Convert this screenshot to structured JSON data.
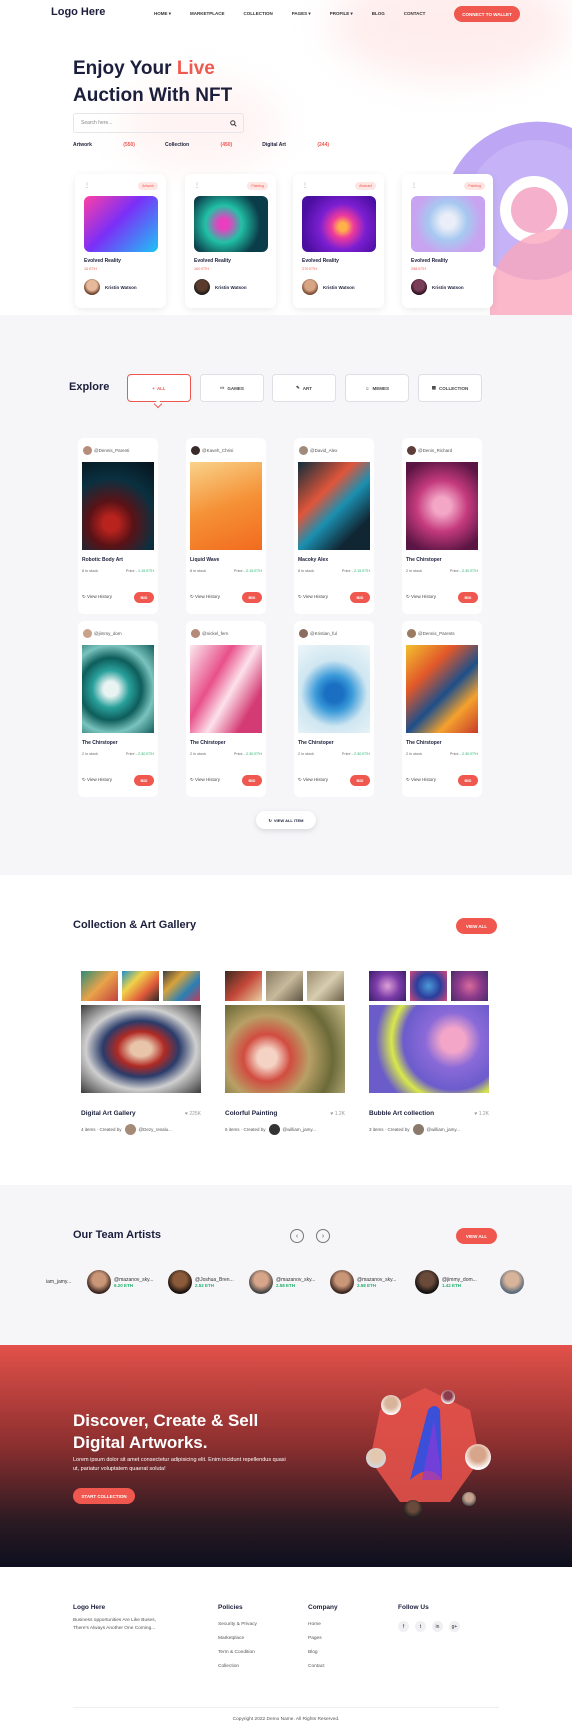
{
  "nav": {
    "logo": "Logo Here",
    "menu": [
      "HOME ▾",
      "MARKETPLACE",
      "COLLECTION",
      "PAGES ▾",
      "PROFILE ▾",
      "BLOG",
      "CONTACT"
    ],
    "connect": "CONNECT TO WALLET"
  },
  "hero": {
    "title_1": "Enjoy Your ",
    "title_live": "Live",
    "title_2": "Auction With NFT",
    "search_placeholder": "Search here...",
    "stats": [
      {
        "label": "Artwork",
        "count": "(550)"
      },
      {
        "label": "Collection",
        "count": "(450)"
      },
      {
        "label": "Digital Art",
        "count": "(244)"
      }
    ]
  },
  "auction_cards": [
    {
      "tag": "Artwork",
      "title": "Evolved Reality",
      "price": "10 ETH",
      "user": "Kristin Watson"
    },
    {
      "tag": "Painting",
      "title": "Evolved Reality",
      "price": "100 ETH",
      "user": "Kristin Watson"
    },
    {
      "tag": "Abstract",
      "title": "Evolved Reality",
      "price": "270 ETH",
      "user": "Kristin Watson"
    },
    {
      "tag": "Painting",
      "title": "Evolved Reality",
      "price": "258 ETH",
      "user": "Kristin Watson"
    }
  ],
  "explore": {
    "title": "Explore",
    "filters": [
      "ALL",
      "GAMES",
      "ART",
      "MEMES",
      "COLLECTION"
    ],
    "items": [
      {
        "owner": "@Dennis_Parenti",
        "name": "Robotic Body Art",
        "stock": "8 in stock",
        "price": "1.15 ETH"
      },
      {
        "owner": "@Kaveh_Chrisi",
        "name": "Liquid Wave",
        "stock": "8 in stock",
        "price": "2.15 ETH"
      },
      {
        "owner": "@David_Alex",
        "name": "Macoky Alex",
        "stock": "8 in stock",
        "price": "2.15 ETH"
      },
      {
        "owner": "@Denis_Richard",
        "name": "The Chirstoper",
        "stock": "2 in stock",
        "price": "2.30 ETH"
      },
      {
        "owner": "@jimmy_dom",
        "name": "The Chirstoper",
        "stock": "2 in stock",
        "price": "2.30 ETH"
      },
      {
        "owner": "@nickel_fern",
        "name": "The Chirstoper",
        "stock": "2 in stock",
        "price": "2.30 ETH"
      },
      {
        "owner": "@Kristian_ful",
        "name": "The Chirstoper",
        "stock": "2 in stock",
        "price": "2.30 ETH"
      },
      {
        "owner": "@Dennis_Parents",
        "name": "The Chirstoper",
        "stock": "2 in stock",
        "price": "2.30 ETH"
      }
    ],
    "price_label": "Price - ",
    "view_history": "View History",
    "bid": "BID",
    "view_all": "VIEW ALL ITEM"
  },
  "gallery": {
    "title": "Collection & Art Gallery",
    "view_all": "VIEW ALL",
    "items": [
      {
        "title": "Digital Art Gallery",
        "likes": "225K",
        "meta": "4 items · Created by",
        "author": "@Dezy_resalu..."
      },
      {
        "title": "Colorful Painting",
        "likes": "1.2K",
        "meta": "6 items · Created by",
        "author": "@william_jamy..."
      },
      {
        "title": "Bubble Art collection",
        "likes": "1.2K",
        "meta": "3 items · Created by",
        "author": "@william_jamy..."
      }
    ]
  },
  "team": {
    "title": "Our Team Artists",
    "view_all": "VIEW ALL",
    "artists": [
      {
        "name": "iam_jamy...",
        "eth": ""
      },
      {
        "name": "@mazanov_sky...",
        "eth": "6.20 ETH"
      },
      {
        "name": "@Joshua_Bren...",
        "eth": "2.52 ETH"
      },
      {
        "name": "@mazanov_sky...",
        "eth": "2.58 ETH"
      },
      {
        "name": "@mazanov_sky...",
        "eth": "2.58 ETH"
      },
      {
        "name": "@jimmy_dom...",
        "eth": "1.42 ETH"
      }
    ]
  },
  "discover": {
    "title_1": "Discover, Create & Sell",
    "title_2": "Digital Artworks.",
    "text": "Lorem ipsum dolor sit amet consectetur adipisicing elit. Enim incidunt repellendus quasi ut, pariatur voluptatem quaerat soluta!",
    "button": "START COLLECTION"
  },
  "footer": {
    "logo": "Logo Here",
    "about": "Business opportunities Are Like Buses, There's Always Another One Coming...",
    "policies_title": "Policies",
    "policies": [
      "Security & Privacy",
      "Marketplace",
      "Term & Condition",
      "Collection"
    ],
    "company_title": "Company",
    "company": [
      "Home",
      "Pages",
      "Blog",
      "Contact"
    ],
    "follow_title": "Follow Us",
    "social": [
      "f",
      "t",
      "in",
      "g+"
    ],
    "copyright": "Copyright 2022 Demo Name. All Rights Reserved."
  },
  "colors": {
    "accent": "#f0584f",
    "green": "#20b26b",
    "dark": "#1b1f3b"
  }
}
